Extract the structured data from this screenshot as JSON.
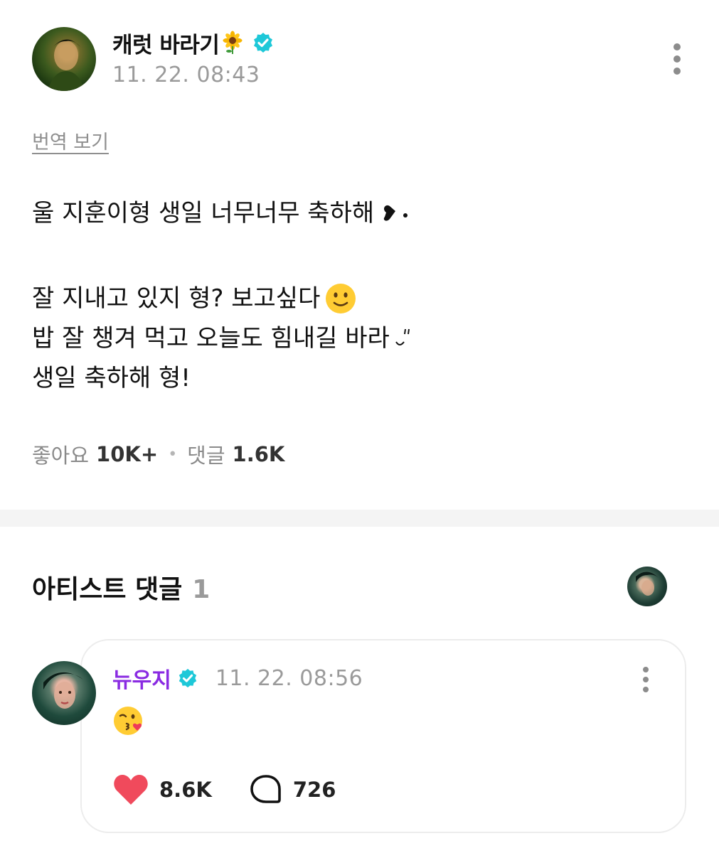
{
  "post": {
    "author": "캐럿 바라기",
    "timestamp": "11. 22. 08:43",
    "translate_label": "번역 보기",
    "lines": [
      "울 지훈이형 생일 너무너무 축하해",
      "잘 지내고 있지 형? 보고싶다",
      "밥 잘 챙겨 먹고 오늘도 힘내길 바라",
      "생일 축하해 형!"
    ],
    "likes_label": "좋아요",
    "likes_count": "10K+",
    "comments_label": "댓글",
    "comments_count": "1.6K"
  },
  "artist_comments": {
    "title": "아티스트 댓글",
    "count": "1",
    "comment": {
      "author": "뉴우지",
      "timestamp": "11. 22. 08:56",
      "emoji": "kissing-heart-emoji",
      "like_count": "8.6K",
      "reply_count": "726"
    }
  },
  "colors": {
    "verified": "#1ec8d8",
    "artist_name": "#8a2be2",
    "heart": "#f04a5c",
    "divider": "#f4f4f4"
  },
  "icons": [
    "sunflower-icon",
    "verified-icon",
    "more-vertical-icon",
    "heart-icon",
    "comment-bubble-icon"
  ]
}
